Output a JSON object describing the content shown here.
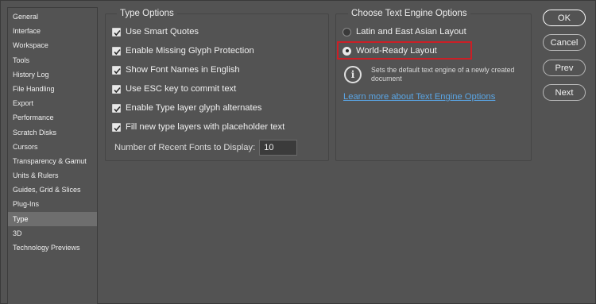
{
  "sidebar": {
    "items": [
      {
        "label": "General"
      },
      {
        "label": "Interface"
      },
      {
        "label": "Workspace"
      },
      {
        "label": "Tools"
      },
      {
        "label": "History Log"
      },
      {
        "label": "File Handling"
      },
      {
        "label": "Export"
      },
      {
        "label": "Performance"
      },
      {
        "label": "Scratch Disks"
      },
      {
        "label": "Cursors"
      },
      {
        "label": "Transparency & Gamut"
      },
      {
        "label": "Units & Rulers"
      },
      {
        "label": "Guides, Grid & Slices"
      },
      {
        "label": "Plug-Ins"
      },
      {
        "label": "Type"
      },
      {
        "label": "3D"
      },
      {
        "label": "Technology Previews"
      }
    ],
    "active": "Type"
  },
  "type_options": {
    "title": "Type Options",
    "checkboxes": [
      {
        "label": "Use Smart Quotes",
        "checked": true
      },
      {
        "label": "Enable Missing Glyph Protection",
        "checked": true
      },
      {
        "label": "Show Font Names in English",
        "checked": true
      },
      {
        "label": "Use ESC key to commit text",
        "checked": true
      },
      {
        "label": "Enable Type layer glyph alternates",
        "checked": true
      },
      {
        "label": "Fill new type layers with placeholder text",
        "checked": true
      }
    ],
    "recent_fonts_label": "Number of Recent Fonts to Display:",
    "recent_fonts_value": "10"
  },
  "text_engine": {
    "title": "Choose Text Engine Options",
    "options": [
      {
        "label": "Latin and East Asian Layout",
        "selected": false
      },
      {
        "label": "World-Ready Layout",
        "selected": true
      }
    ],
    "info_text": "Sets the default text engine of a newly created document",
    "learn_more": "Learn more about Text Engine Options",
    "info_icon": "info-icon"
  },
  "buttons": {
    "ok": "OK",
    "cancel": "Cancel",
    "prev": "Prev",
    "next": "Next"
  },
  "colors": {
    "background": "#535353",
    "link": "#5aa6e6",
    "highlight": "#cc1f26"
  }
}
